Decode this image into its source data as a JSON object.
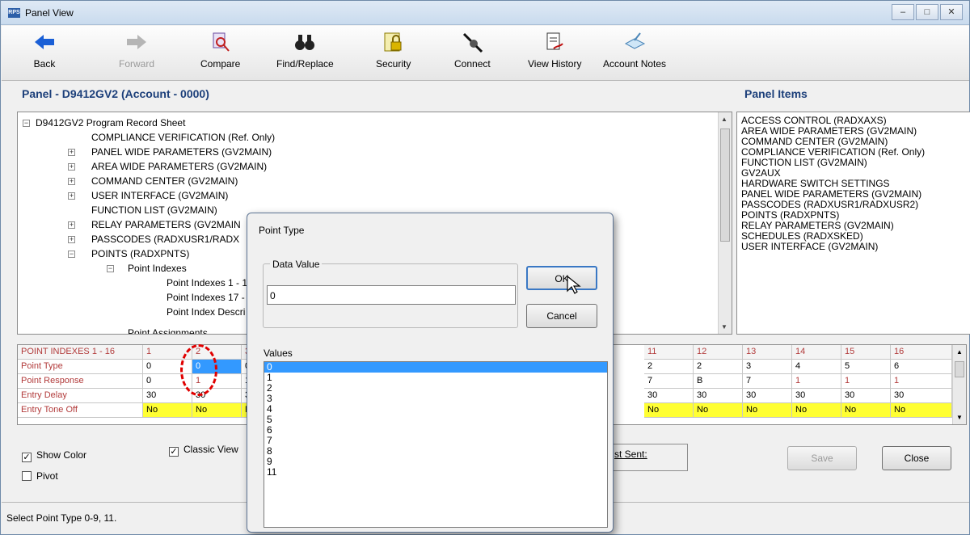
{
  "window": {
    "title": "Panel View",
    "app_icon": "rps-icon"
  },
  "toolbar": {
    "back": "Back",
    "forward": "Forward",
    "compare": "Compare",
    "find_replace": "Find/Replace",
    "security": "Security",
    "connect": "Connect",
    "view_history": "View History",
    "account_notes": "Account Notes"
  },
  "panel": {
    "header": "Panel - D9412GV2 (Account - 0000)"
  },
  "panel_items": {
    "header": "Panel Items",
    "items": [
      "ACCESS CONTROL (RADXAXS)",
      "AREA WIDE PARAMETERS (GV2MAIN)",
      "COMMAND CENTER (GV2MAIN)",
      "COMPLIANCE VERIFICATION (Ref. Only)",
      "FUNCTION LIST (GV2MAIN)",
      "GV2AUX",
      "HARDWARE SWITCH SETTINGS",
      "PANEL WIDE PARAMETERS (GV2MAIN)",
      "PASSCODES (RADXUSR1/RADXUSR2)",
      "POINTS (RADXPNTS)",
      "RELAY PARAMETERS (GV2MAIN)",
      "SCHEDULES (RADXSKED)",
      "USER INTERFACE (GV2MAIN)"
    ]
  },
  "tree": [
    "D9412GV2 Program Record Sheet",
    "COMPLIANCE VERIFICATION (Ref. Only)",
    "PANEL WIDE PARAMETERS (GV2MAIN)",
    "AREA WIDE PARAMETERS (GV2MAIN)",
    "COMMAND CENTER (GV2MAIN)",
    "USER INTERFACE (GV2MAIN)",
    "FUNCTION LIST (GV2MAIN)",
    "RELAY PARAMETERS (GV2MAIN",
    "PASSCODES (RADXUSR1/RADX",
    "POINTS (RADXPNTS)",
    "Point Indexes",
    "Point Indexes 1 - 1",
    "Point Indexes 17 -",
    "Point Index Descri",
    "Point Assignments"
  ],
  "grid": {
    "header_label": "POINT INDEXES 1 - 16",
    "col_left": [
      "1",
      "2",
      "3"
    ],
    "col_right": [
      "11",
      "12",
      "13",
      "14",
      "15",
      "16"
    ],
    "rows": [
      {
        "label": "Point Type",
        "left": [
          "0",
          "0",
          "0"
        ],
        "right": [
          "2",
          "2",
          "3",
          "4",
          "5",
          "6"
        ]
      },
      {
        "label": "Point Response",
        "left": [
          "0",
          "1",
          "1"
        ],
        "right": [
          "7",
          "B",
          "7",
          "1",
          "1",
          "1"
        ]
      },
      {
        "label": "Entry Delay",
        "left": [
          "30",
          "30",
          "30"
        ],
        "right": [
          "30",
          "30",
          "30",
          "30",
          "30",
          "30"
        ]
      },
      {
        "label": "Entry Tone Off",
        "left": [
          "No",
          "No",
          "No"
        ],
        "right": [
          "No",
          "No",
          "No",
          "No",
          "No",
          "No"
        ]
      }
    ]
  },
  "options": {
    "show_color": "Show Color",
    "classic_view": "Classic View",
    "pivot": "Pivot"
  },
  "last_sent": {
    "label": "st Sent:"
  },
  "buttons": {
    "save": "Save",
    "close": "Close"
  },
  "status": {
    "text": "Select Point Type 0-9, 11."
  },
  "dialog": {
    "title": "Point Type",
    "group_label": "Data Value",
    "input_value": "0",
    "ok": "OK",
    "cancel": "Cancel",
    "values_label": "Values",
    "values": [
      "0",
      "1",
      "2",
      "3",
      "4",
      "5",
      "6",
      "7",
      "8",
      "9",
      "11"
    ]
  },
  "colors": {
    "accent": "#1c3f7a",
    "selection": "#3399ff",
    "highlight": "#ffff33",
    "grid_label": "#b23b3b",
    "marker": "#e00000"
  }
}
